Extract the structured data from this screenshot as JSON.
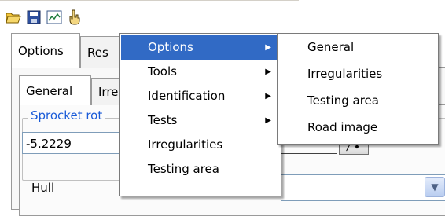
{
  "toolbar": {
    "icons": [
      "open-folder-icon",
      "save-icon",
      "chart-icon",
      "pointer-hand-icon"
    ]
  },
  "tabs": {
    "outer": [
      "Options",
      "Res"
    ],
    "inner": [
      "General",
      "Irre"
    ]
  },
  "group": {
    "legend": "Sprocket rot"
  },
  "field": {
    "value": "-5.2229"
  },
  "hull": {
    "label": "Hull"
  },
  "context_menu": {
    "items": [
      {
        "label": "Options",
        "submenu": true
      },
      {
        "label": "Tools",
        "submenu": true
      },
      {
        "label": "Identification",
        "submenu": true
      },
      {
        "label": "Tests",
        "submenu": true
      },
      {
        "label": "Irregularities",
        "submenu": false
      },
      {
        "label": "Testing area",
        "submenu": false
      }
    ],
    "highlighted": "Options"
  },
  "submenu": {
    "items": [
      "General",
      "Irregularities",
      "Testing area",
      "Road image"
    ]
  },
  "colors": {
    "highlight": "#316ac5",
    "legend_text": "#1a5bd8"
  }
}
